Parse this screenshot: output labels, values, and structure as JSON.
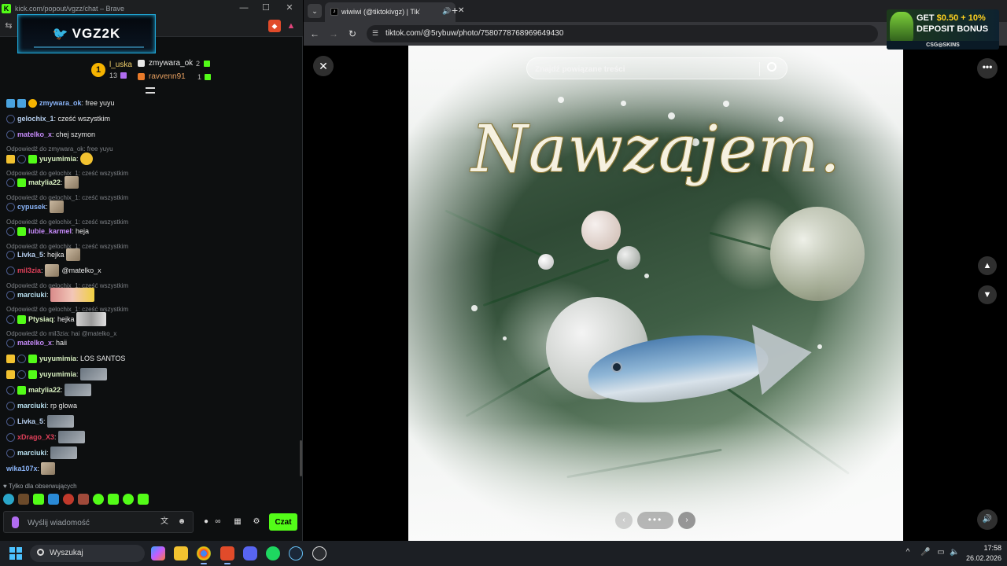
{
  "left_window": {
    "title": "kick.com/popout/vgzz/chat – Brave",
    "banner": "VGZ2K",
    "leaders": {
      "first": {
        "rank": "1",
        "name": "l_uska",
        "count": "13"
      },
      "second": {
        "name": "zmywara_ok",
        "count": "2"
      },
      "third": {
        "name": "ravvenn91",
        "count": "1"
      }
    },
    "messages": [
      {
        "user": "zmywara_ok",
        "text": ": free yuyu",
        "color": "#8ab4f8"
      },
      {
        "user": "gelochix_1",
        "text": ": cześć wszystkim",
        "color": "#b8d0f0"
      },
      {
        "user": "matelko_x",
        "text": ": chej szymon",
        "color": "#c58af9"
      },
      {
        "reply": "Odpowiedź do zmywara_ok: free yuyu"
      },
      {
        "user": "yuyumimia",
        "text": ":",
        "color": "#d8f0c0"
      },
      {
        "reply": "Odpowiedź do gelochix_1: cześć wszystkim"
      },
      {
        "user": "matylia22",
        "text": ":",
        "color": "#d8f0c0"
      },
      {
        "reply": "Odpowiedź do gelochix_1: cześć wszystkim"
      },
      {
        "user": "cypusek",
        "text": ":",
        "color": "#8ab4f8"
      },
      {
        "reply": "Odpowiedź do gelochix_1: cześć wszystkim"
      },
      {
        "user": "lubie_karmel",
        "text": ": heja",
        "color": "#c58af9"
      },
      {
        "reply": "Odpowiedź do gelochix_1: cześć wszystkim"
      },
      {
        "user": "Livka_5",
        "text": ": hejka",
        "color": "#b8d0f0"
      },
      {
        "user": "mil3zia",
        "text": ":",
        "text2": "@matelko_x",
        "color": "#e0405a"
      },
      {
        "reply": "Odpowiedź do gelochix_1: cześć wszystkim"
      },
      {
        "user": "marciuki",
        "text": ":",
        "color": "#b8e0f0"
      },
      {
        "reply": "Odpowiedź do gelochix_1: cześć wszystkim"
      },
      {
        "user": "Ptysiaq",
        "text": ": hejka",
        "color": "#d8f0c0"
      },
      {
        "reply": "Odpowiedź do mil3zia: hai @matelko_x"
      },
      {
        "user": "matelko_x",
        "text": ": haii",
        "color": "#c58af9"
      },
      {
        "user": "yuyumimia",
        "text": ": LOS SANTOS",
        "color": "#d8f0c0"
      },
      {
        "user": "yuyumimia",
        "text": ":",
        "color": "#d8f0c0"
      },
      {
        "user": "matylia22",
        "text": ":",
        "color": "#d8f0c0"
      },
      {
        "user": "marciuki",
        "text": ": rp glowa",
        "color": "#b8e0f0"
      },
      {
        "user": "Livka_5",
        "text": ":",
        "color": "#b8d0f0"
      },
      {
        "user": "xDrago_X3",
        "text": ":",
        "color": "#e0405a"
      },
      {
        "user": "marciuki",
        "text": ":",
        "color": "#b8e0f0"
      },
      {
        "user": "wika107x",
        "text": ":",
        "color": "#8ab4f8"
      }
    ],
    "followers_only": "Tylko dla obserwujących",
    "input_placeholder": "Wyślij wiadomość",
    "send_label": "Czat"
  },
  "browser": {
    "tab_title": "wiwiwi (@tiktokivgz) | TikTo",
    "url": "tiktok.com/@5rybuw/photo/7580778768969649430",
    "search_placeholder": "Znajdź powiązane treści",
    "photo_text": "Nawzajem."
  },
  "ad": {
    "line1_a": "GET ",
    "line1_b": "$0.50 + 10%",
    "line2": "DEPOSIT BONUS",
    "brand": "CSG◎SKINS"
  },
  "taskbar": {
    "search_label": "Wyszukaj",
    "time": "17:58",
    "date": "26.02.2026"
  },
  "colors": {
    "kick_green": "#53fc18",
    "brave_orange": "#e14b2a",
    "browser_bg": "#202124"
  }
}
